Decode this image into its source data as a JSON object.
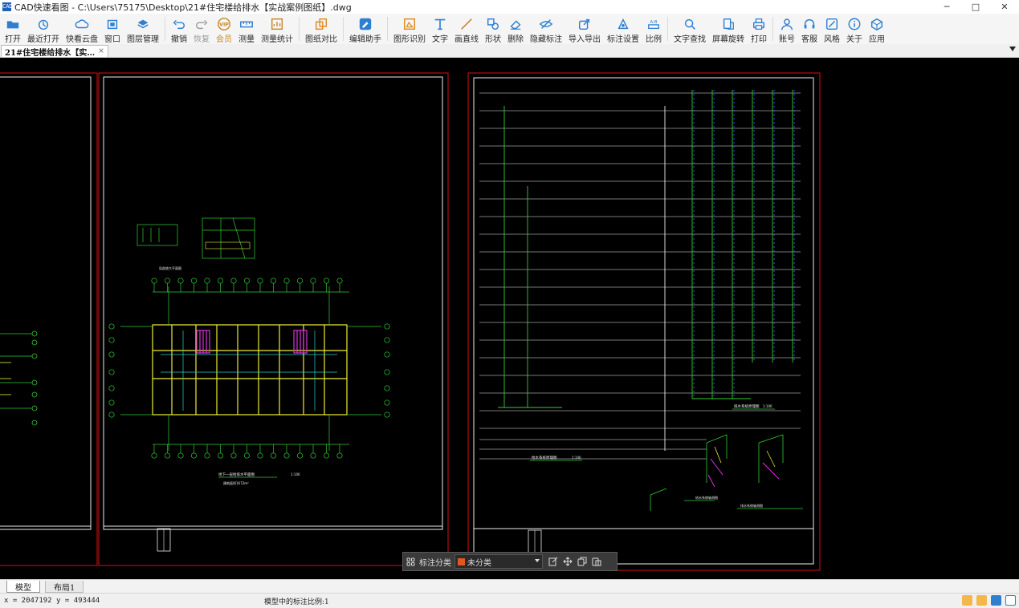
{
  "window": {
    "title": "CAD快速看图 - C:\\Users\\75175\\Desktop\\21#住宅楼给排水【实战案例图纸】.dwg",
    "app_icon": "cad-app-icon",
    "controls": {
      "minimize": "─",
      "maximize": "□",
      "close": "✕"
    }
  },
  "toolbar": {
    "items": [
      {
        "id": "open",
        "label": "打开",
        "icon": "folder-open-icon",
        "color": "#2f7fd1"
      },
      {
        "id": "recent",
        "label": "最近打开",
        "icon": "clock-history-icon",
        "color": "#2f7fd1"
      },
      {
        "id": "cloud",
        "label": "快看云盘",
        "icon": "cloud-icon",
        "color": "#2f7fd1"
      },
      {
        "id": "window",
        "label": "窗口",
        "icon": "window-frame-icon",
        "color": "#2f7fd1"
      },
      {
        "id": "layers",
        "label": "图层管理",
        "icon": "layers-icon",
        "color": "#2f7fd1"
      },
      {
        "id": "undo",
        "label": "撤销",
        "icon": "undo-icon",
        "color": "#2f7fd1"
      },
      {
        "id": "redo",
        "label": "恢复",
        "icon": "redo-icon",
        "color": "#9a9a9a"
      },
      {
        "id": "vip",
        "label": "会员",
        "icon": "vip-badge-icon",
        "color": "#c8882a"
      },
      {
        "id": "measure",
        "label": "测量",
        "icon": "ruler-icon",
        "color": "#2f7fd1"
      },
      {
        "id": "measure_stats",
        "label": "测量统计",
        "icon": "measure-stats-icon",
        "color": "#c8882a"
      },
      {
        "id": "compare",
        "label": "图纸对比",
        "icon": "compare-sheets-icon",
        "color": "#e08a1e"
      },
      {
        "id": "edit_assist",
        "label": "编辑助手",
        "icon": "edit-assistant-icon",
        "color": "#2f7fd1"
      },
      {
        "id": "shape_recognize",
        "label": "图形识别",
        "icon": "shape-recognize-icon",
        "color": "#e08a1e"
      },
      {
        "id": "text",
        "label": "文字",
        "icon": "text-tool-icon",
        "color": "#2f7fd1"
      },
      {
        "id": "line",
        "label": "画直线",
        "icon": "draw-line-icon",
        "color": "#c8882a"
      },
      {
        "id": "shape",
        "label": "形状",
        "icon": "shapes-icon",
        "color": "#2f7fd1"
      },
      {
        "id": "delete",
        "label": "删除",
        "icon": "eraser-icon",
        "color": "#2f7fd1"
      },
      {
        "id": "hide_marks",
        "label": "隐藏标注",
        "icon": "eye-off-icon",
        "color": "#2f7fd1"
      },
      {
        "id": "import_export",
        "label": "导入导出",
        "icon": "import-export-icon",
        "color": "#2f7fd1"
      },
      {
        "id": "mark_settings",
        "label": "标注设置",
        "icon": "mark-settings-icon",
        "color": "#2f7fd1"
      },
      {
        "id": "ratio",
        "label": "比例",
        "icon": "ratio-icon",
        "color": "#2f7fd1"
      },
      {
        "id": "text_search",
        "label": "文字查找",
        "icon": "text-search-icon",
        "color": "#2f7fd1"
      },
      {
        "id": "rotate",
        "label": "屏幕旋转",
        "icon": "rotate-screen-icon",
        "color": "#2f7fd1"
      },
      {
        "id": "print",
        "label": "打印",
        "icon": "printer-icon",
        "color": "#2f7fd1"
      },
      {
        "id": "account",
        "label": "账号",
        "icon": "user-icon",
        "color": "#2f7fd1"
      },
      {
        "id": "service",
        "label": "客服",
        "icon": "headset-icon",
        "color": "#2f7fd1"
      },
      {
        "id": "style",
        "label": "风格",
        "icon": "style-icon",
        "color": "#2f7fd1"
      },
      {
        "id": "about",
        "label": "关于",
        "icon": "info-icon",
        "color": "#2f7fd1"
      },
      {
        "id": "apps",
        "label": "应用",
        "icon": "apps-cube-icon",
        "color": "#2f7fd1"
      }
    ]
  },
  "document_tab": {
    "label": "21#住宅楼给排水【实…",
    "close": "×"
  },
  "drawing": {
    "sheet1": {
      "plan_title": "地下一层给排水平面图",
      "plan_scale": "1:100",
      "plan_note": "建筑面积1672m²",
      "detail_title": "局部放大平面图"
    },
    "sheet2": {
      "riser_title_1": "给水系统原理图",
      "riser_scale_1": "1:100",
      "riser_title_2": "排水系统原理图",
      "riser_scale_2": "1:100",
      "detail_label_1": "给水系统轴测图",
      "detail_label_2": "排水系统轴测图"
    }
  },
  "float_toolbar": {
    "mark_category_label": "标注分类",
    "category_value": "未分类",
    "category_color": "#e2571e"
  },
  "layout_tabs": {
    "model": "模型",
    "layout1": "布局1"
  },
  "status": {
    "coords": "x = 2047192  y = 493444",
    "scale_text": "模型中的标注比例:1"
  }
}
